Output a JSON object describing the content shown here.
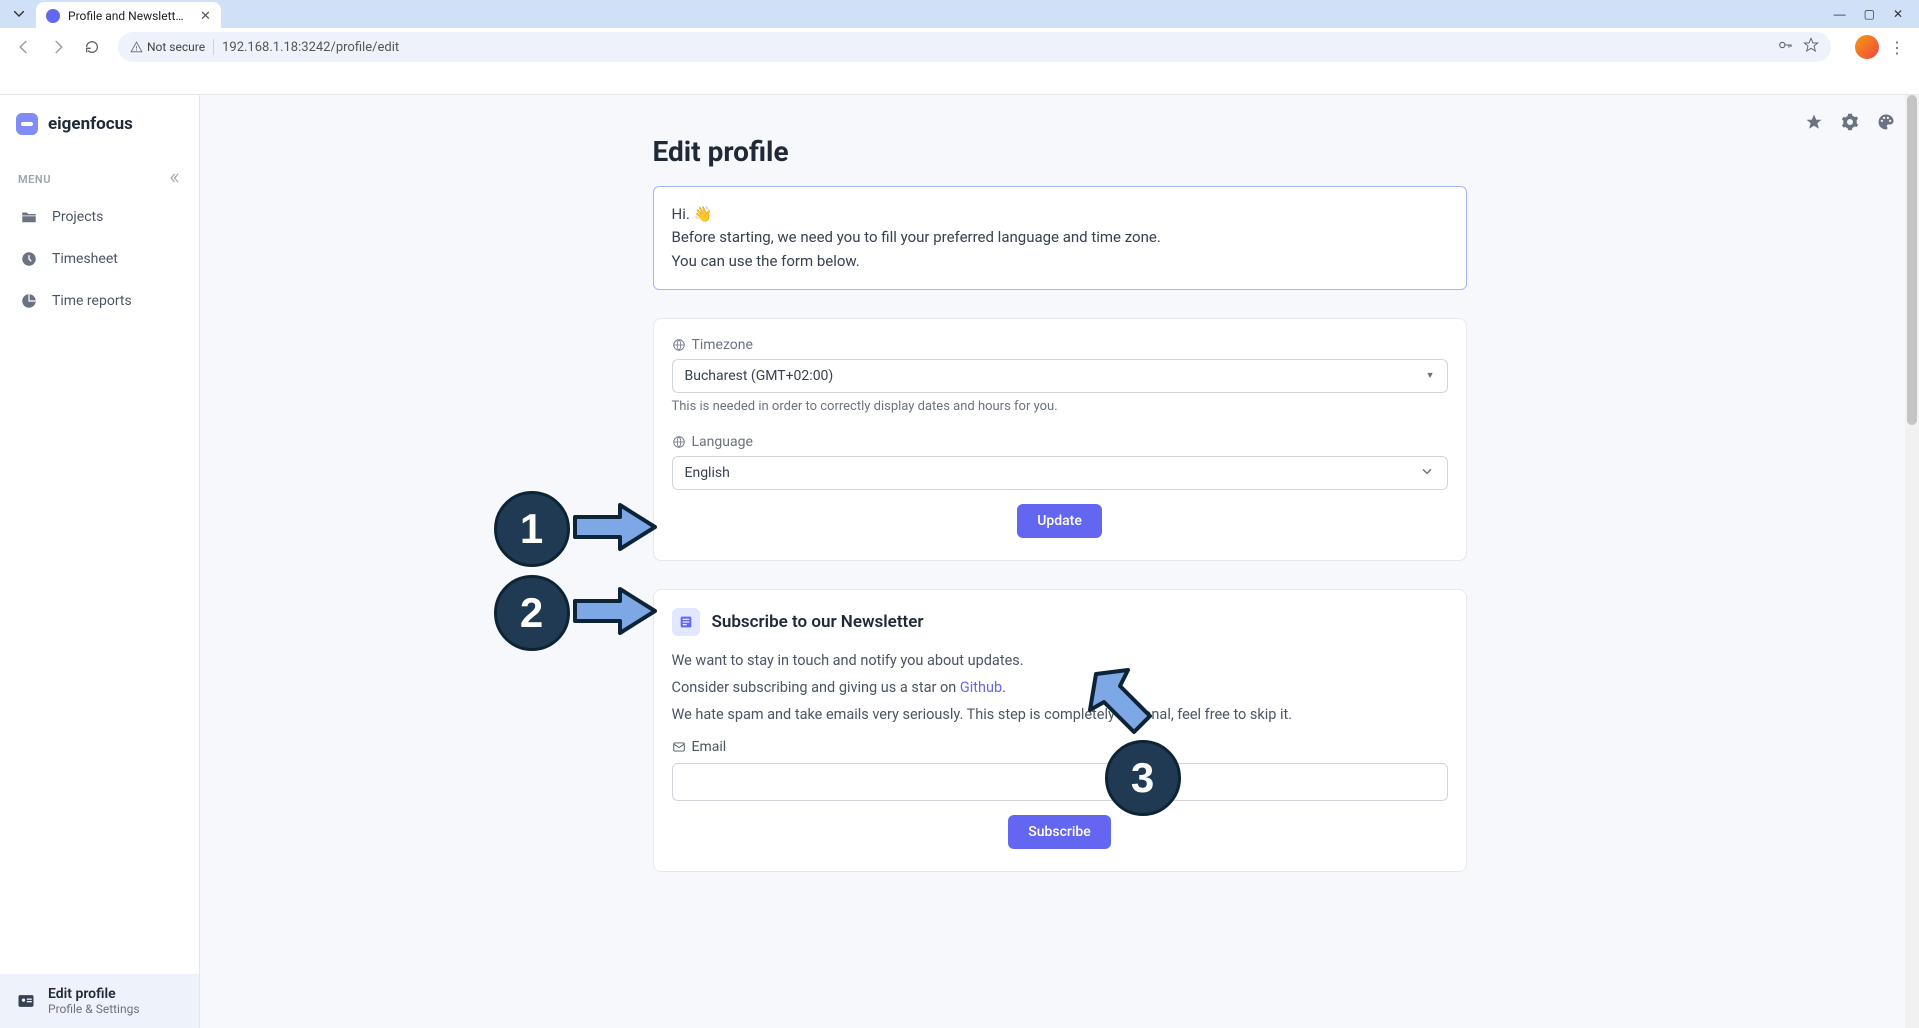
{
  "browser": {
    "tab_title": "Profile and Newsletter | Eigenfo",
    "not_secure": "Not secure",
    "url": "192.168.1.18:3242/profile/edit"
  },
  "brand": {
    "name": "eigenfocus"
  },
  "sidebar": {
    "menu_label": "MENU",
    "items": [
      {
        "label": "Projects"
      },
      {
        "label": "Timesheet"
      },
      {
        "label": "Time reports"
      }
    ],
    "bottom": {
      "title": "Edit profile",
      "subtitle": "Profile & Settings"
    }
  },
  "page": {
    "title": "Edit profile",
    "notice_hi": "Hi.",
    "notice_wave": "👋",
    "notice_line1": "Before starting, we need you to fill your preferred language and time zone.",
    "notice_line2": "You can use the form below."
  },
  "form": {
    "timezone_label": "Timezone",
    "timezone_value": "Bucharest (GMT+02:00)",
    "timezone_help": "This is needed in order to correctly display dates and hours for you.",
    "language_label": "Language",
    "language_value": "English",
    "update_button": "Update"
  },
  "newsletter": {
    "title": "Subscribe to our Newsletter",
    "p1": "We want to stay in touch and notify you about updates.",
    "p2_prefix": "Consider subscribing and giving us a star on ",
    "p2_link": "Github",
    "p2_suffix": ".",
    "p3": "We hate spam and take emails very seriously. This step is completely optional, feel free to skip it.",
    "email_label": "Email",
    "subscribe_button": "Subscribe"
  },
  "annotations": {
    "n1": "1",
    "n2": "2",
    "n3": "3"
  }
}
